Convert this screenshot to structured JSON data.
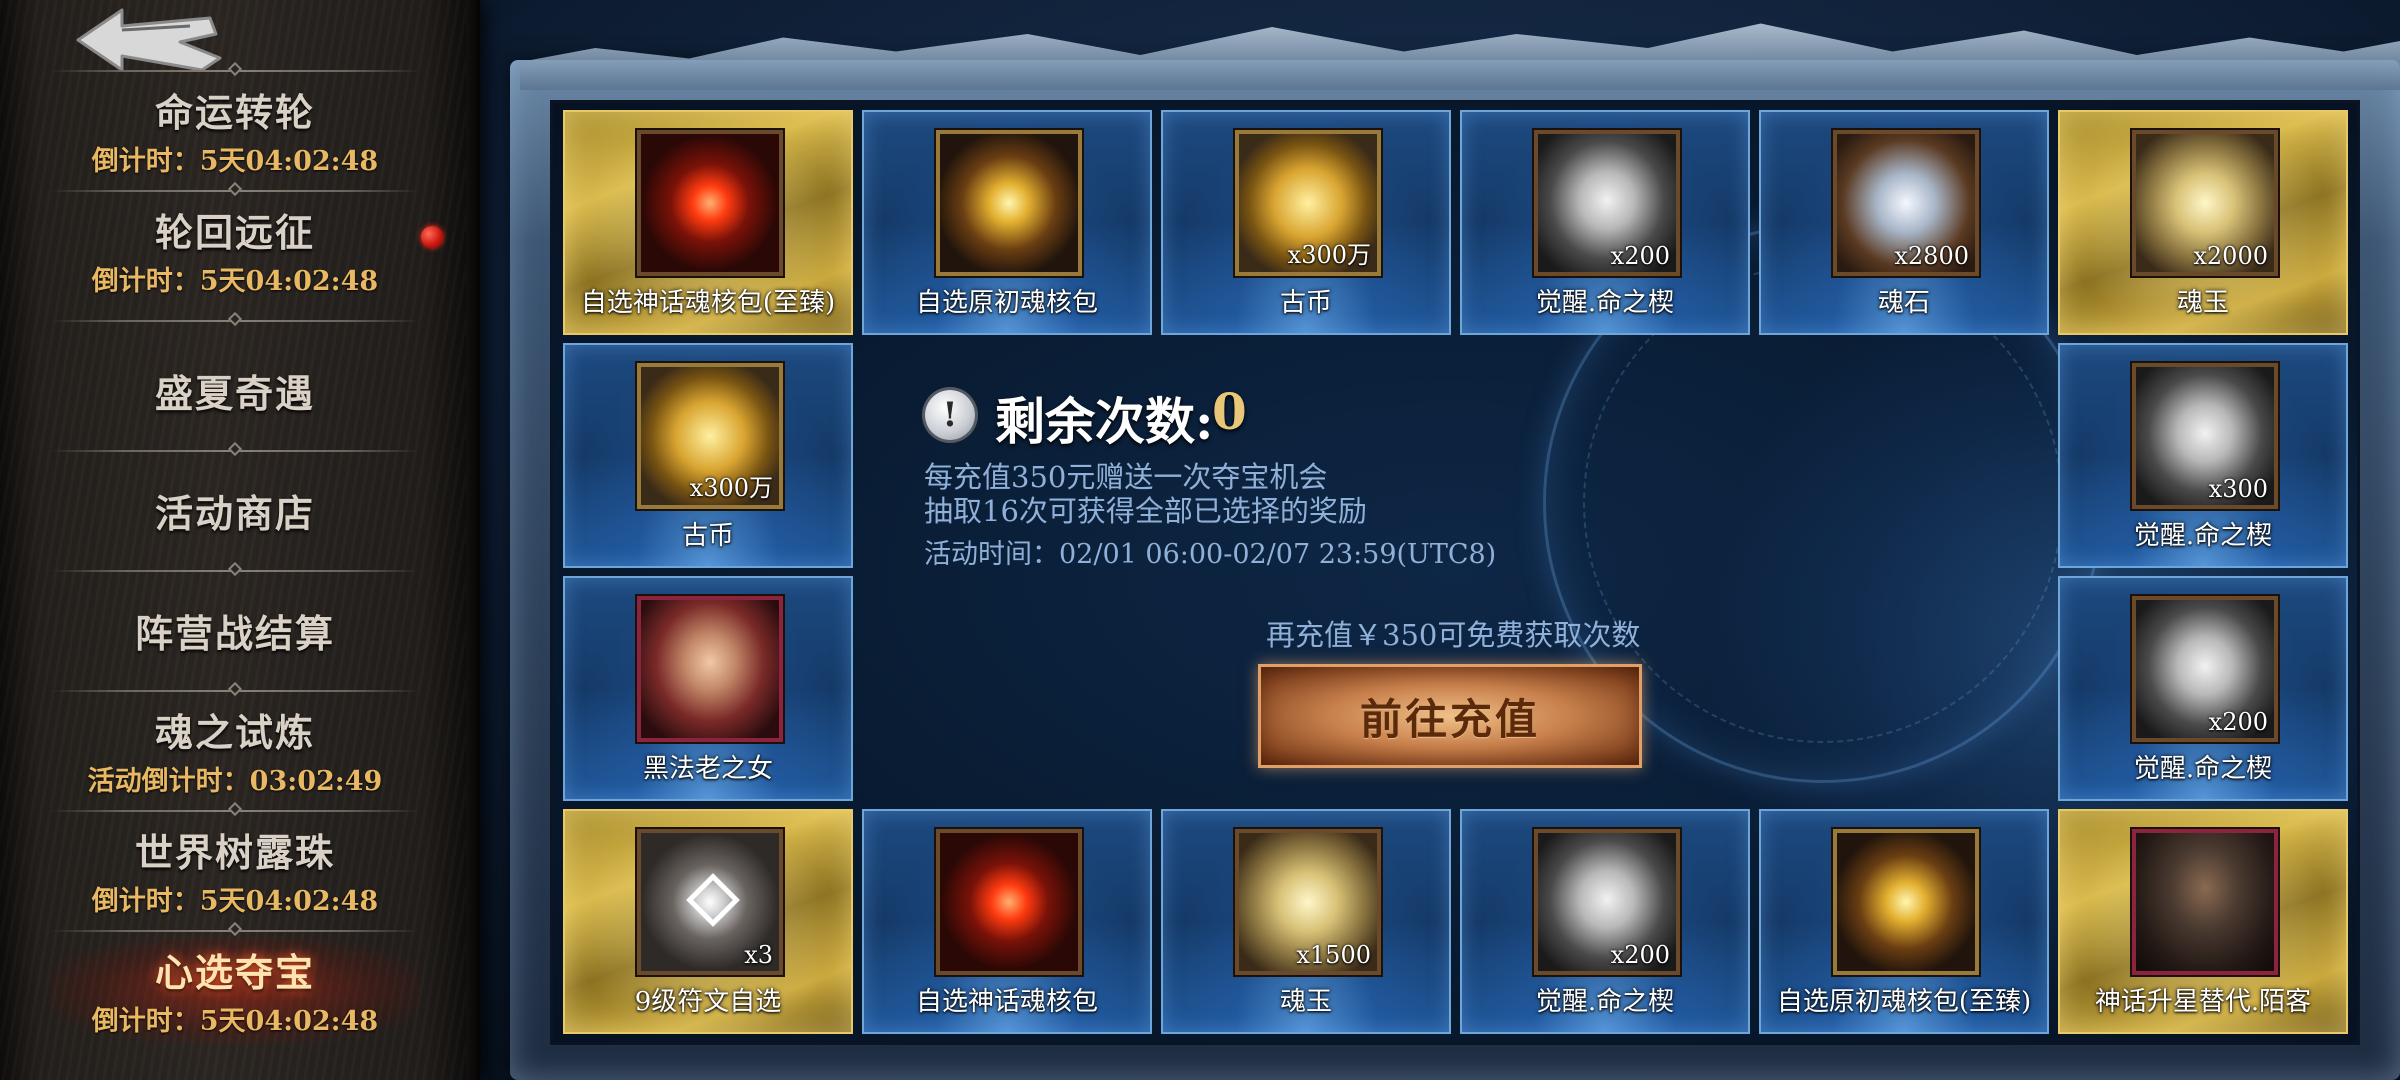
{
  "sidebar": {
    "back_icon": "back-arrow-icon",
    "items": [
      {
        "title": "命运转轮",
        "subtitle": "倒计时：5天04:02:48",
        "active": false
      },
      {
        "title": "轮回远征",
        "subtitle": "倒计时：5天04:02:48",
        "active": false,
        "has_red_dot": true
      },
      {
        "title": "盛夏奇遇",
        "subtitle": "",
        "active": false
      },
      {
        "title": "活动商店",
        "subtitle": "",
        "active": false
      },
      {
        "title": "阵营战结算",
        "subtitle": "",
        "active": false
      },
      {
        "title": "魂之试炼",
        "subtitle": "活动倒计时：03:02:49",
        "active": false
      },
      {
        "title": "世界树露珠",
        "subtitle": "倒计时：5天04:02:48",
        "active": false
      },
      {
        "title": "心选夺宝",
        "subtitle": "倒计时：5天04:02:48",
        "active": true
      }
    ]
  },
  "rewards": [
    {
      "label": "自选神话魂核包(至臻)",
      "count": "",
      "tier": "gold",
      "icon": "red-core-pack-icon"
    },
    {
      "label": "自选原初魂核包",
      "count": "",
      "tier": "blue",
      "icon": "gold-core-pack-icon"
    },
    {
      "label": "古币",
      "count": "x300万",
      "tier": "blue",
      "icon": "ancient-coin-icon"
    },
    {
      "label": "觉醒.命之楔",
      "count": "x200",
      "tier": "blue",
      "icon": "awakening-mask-icon"
    },
    {
      "label": "魂石",
      "count": "x2800",
      "tier": "blue",
      "icon": "soul-stone-icon"
    },
    {
      "label": "魂玉",
      "count": "x2000",
      "tier": "gold",
      "icon": "soul-jade-icon"
    },
    {
      "label": "古币",
      "count": "x300万",
      "tier": "blue",
      "icon": "ancient-coin-icon"
    },
    {
      "label": "觉醒.命之楔",
      "count": "x300",
      "tier": "blue",
      "icon": "awakening-mask-icon"
    },
    {
      "label": "黑法老之女",
      "count": "",
      "tier": "blue",
      "icon": "hero-portrait-icon"
    },
    {
      "label": "觉醒.命之楔",
      "count": "x200",
      "tier": "blue",
      "icon": "awakening-mask-icon"
    },
    {
      "label": "9级符文自选",
      "count": "x3",
      "tier": "gold",
      "icon": "rune-icon"
    },
    {
      "label": "自选神话魂核包",
      "count": "",
      "tier": "blue",
      "icon": "red-core-pack-icon"
    },
    {
      "label": "魂玉",
      "count": "x1500",
      "tier": "blue",
      "icon": "soul-jade-icon"
    },
    {
      "label": "觉醒.命之楔",
      "count": "x200",
      "tier": "blue",
      "icon": "awakening-mask-icon"
    },
    {
      "label": "自选原初魂核包(至臻)",
      "count": "",
      "tier": "blue",
      "icon": "gold-core-pack-icon"
    },
    {
      "label": "神话升星替代.陌客",
      "count": "",
      "tier": "gold",
      "icon": "hero-knight-icon"
    }
  ],
  "center": {
    "info_icon": "exclamation-icon",
    "remaining_label": "剩余次数:",
    "remaining_value": "0",
    "desc_line1": "每充值350元赠送一次夺宝机会",
    "desc_line2": "抽取16次可获得全部已选择的奖励",
    "time_label": "活动时间：",
    "time_value": "02/01 06:00-02/07 23:59(UTC8)",
    "recharge_hint": "再充值￥350可免费获取次数",
    "recharge_button": "前往充值"
  },
  "colors": {
    "sidebar_text": "#d9d0c6",
    "countdown_text": "#e9b862",
    "active_glow": "#ff5a2a",
    "tile_blue": "#1d4a80",
    "tile_gold": "#d8b94b",
    "remaining_value": "#e8c878",
    "info_text": "#8fb0d8",
    "button": "#c8804c"
  }
}
